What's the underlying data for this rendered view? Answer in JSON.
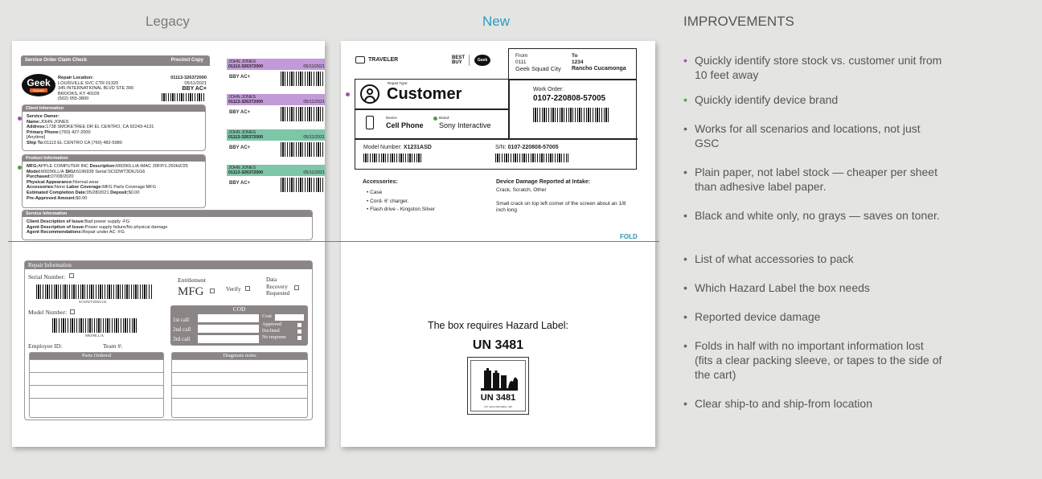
{
  "headings": {
    "legacy": "Legacy",
    "new": "New",
    "improvements": "IMPROVEMENTS"
  },
  "colors": {
    "purple": "#a0559b",
    "green": "#4aa340",
    "new_heading": "#2a9bc0",
    "fold_line": "#2a96b4"
  },
  "legacy": {
    "header_title": "Service Order Claim Check",
    "header_copy": "Precinct Copy",
    "logo_text": "Geek",
    "logo_sub": "SQUAD",
    "repair_location_label": "Repair Location:",
    "repair_location_lines": [
      "LOUISVILLE SVC CTR 01320",
      "345 INTERNATIONAL BLVD STE 300",
      "BROOKS, KY 40109",
      "(502) 955-3800"
    ],
    "order_num": "01113-326372000",
    "order_date": "05/11/2021",
    "order_tag": "BBY AC+",
    "client_info": {
      "title": "Client Information",
      "service_owner_label": "Service Owner:",
      "name_label": "Name:",
      "name": "JOHN JONES",
      "address_label": "Address:",
      "address": "1738 SMOKETREE DR  EL CENTRO, CA 92243-4131",
      "phone_label": "Primary Phone:",
      "phone": "(760) 427-2000",
      "anytime": "[Anytime]",
      "ship_label": "Ship To:",
      "ship": "01113 EL CENTRO CA (760) 482-5980"
    },
    "product_info": {
      "title": "Product Information",
      "lines": [
        {
          "l": "MFG:",
          "v": "APPLE COMPUTER INC",
          "l2": " Description:",
          "v2": "M9290LL/A IMAC 20FP/1.250HZ/25"
        },
        {
          "l": "Model:",
          "v": "M9290LL/A",
          "l2": "  SKU:",
          "v2": "6196939  Serial:SC02WT3D6J1G6"
        },
        {
          "l": "Purchased:",
          "v": "07/08/2020",
          "l2": "",
          "v2": ""
        },
        {
          "l": "Physical Appearance:",
          "v": "Normal wear",
          "l2": "",
          "v2": ""
        },
        {
          "l": "Accessories:",
          "v": "None",
          "l2": " Labor Coverage:",
          "v2": "MFG  Parts Coverage:MFG"
        },
        {
          "l": "Estimated Completion Date:",
          "v": "05/28/2021",
          "l2": "  Deposit:",
          "v2": "$0.00"
        },
        {
          "l": "Pre-Approved Amount:",
          "v": "$0.00",
          "l2": "",
          "v2": ""
        }
      ]
    },
    "service_info": {
      "title": "Service Information",
      "lines": [
        {
          "l": "Client Description of Issue:",
          "v": "Bad power supply -FG"
        },
        {
          "l": "Agent Description of Issue:",
          "v": "Power supply failure/No physical damage"
        },
        {
          "l": "Agent Recommendations:",
          "v": "Repair under AC -FG"
        }
      ]
    },
    "tags": [
      {
        "name": "JOHN JONES",
        "num": "01113-326372000",
        "date": "05/11/2021",
        "label": "BBY AC+",
        "color": "#c39ad8"
      },
      {
        "name": "JOHN JONES",
        "num": "01113-326372000",
        "date": "05/11/2021",
        "label": "BBY AC+",
        "color": "#c39ad8"
      },
      {
        "name": "JOHN JONES",
        "num": "01113-326372000",
        "date": "05/11/2021",
        "label": "BBY AC+",
        "color": "#7ec6a8"
      },
      {
        "name": "JOHN JONES",
        "num": "01113-326372000",
        "date": "05/11/2021",
        "label": "BBY AC+",
        "color": "#7ec6a8"
      }
    ],
    "repair": {
      "title": "Repair Information",
      "serial_label": "Serial Number:",
      "serial_value": "SC02WT3D6J1G6",
      "model_label": "Model Number:",
      "model_value": "M9290LL/A",
      "entitlement_label": "Entitlement",
      "entitlement_value": "MFG",
      "verify_label": "Verify",
      "data_recovery_label": "Data Recovery Requested",
      "cod_title": "COD",
      "calls": [
        "1st call",
        "2nd call",
        "3rd call"
      ],
      "cost_label": "Cost",
      "statuses": [
        "Approved",
        "Declined",
        "No response"
      ],
      "employee_label": "Employee ID:",
      "team_label": "Team #:",
      "parts_title": "Parts Ordered",
      "diagnosis_title": "Diagnosis notes"
    }
  },
  "new": {
    "traveler": "TRAVELER",
    "brand_logo": "BEST BUY",
    "brand_logo2": "Geek",
    "from_label": "From",
    "from_num": "0111",
    "from_name": "Geek Squad City",
    "to_label": "To",
    "to_num": "1234",
    "to_name": "Rancho Cucamonga",
    "repair_type_label": "Repair Type:",
    "repair_type": "Customer",
    "work_order_label": "Work Order:",
    "work_order": "0107-220808-57005",
    "device_label": "Device",
    "device": "Cell Phone",
    "brand_label": "Brand:",
    "brand": "Sony Interactive",
    "model_label": "Model Number:",
    "model": "X1231ASD",
    "sn_label": "S/N:",
    "sn": "0107-220808-57005",
    "accessories_label": "Accessories:",
    "accessories": [
      "Case",
      "Cord- 6' charger.",
      "Flash drive - Kingston Silver"
    ],
    "damage_label": "Device Damage Reported at Intake:",
    "damage_types": "Crack, Scratch, Other",
    "damage_note": "Small crack on top left corner of the screen about an 1/8 inch long",
    "fold": "FOLD",
    "hazard_text": "The box requires Hazard Label:",
    "hazard_code": "UN 3481",
    "hazard_label_code": "UN 3481",
    "hazard_small": "For more information, call"
  },
  "improvements": [
    {
      "text": "Quickly identify store stock vs. customer unit from 10 feet away",
      "bullet": "purple"
    },
    {
      "text": "Quickly identify device brand",
      "bullet": "green"
    },
    {
      "text": "Works for all scenarios and locations, not just GSC",
      "bullet": "grey"
    },
    {
      "text": "Plain paper, not label stock — cheaper per sheet than adhesive label paper.",
      "bullet": "grey"
    },
    {
      "text": "Black and white only, no grays — saves on toner.",
      "bullet": "grey"
    },
    {
      "text": "List of what accessories to pack",
      "bullet": "grey"
    },
    {
      "text": "Which Hazard Label the box needs",
      "bullet": "grey"
    },
    {
      "text": "Reported device damage",
      "bullet": "grey"
    },
    {
      "text": "Folds in half with no important information lost (fits a clear packing sleeve, or tapes to the side of the cart)",
      "bullet": "grey"
    },
    {
      "text": "Clear ship-to and ship-from location",
      "bullet": "grey"
    }
  ]
}
